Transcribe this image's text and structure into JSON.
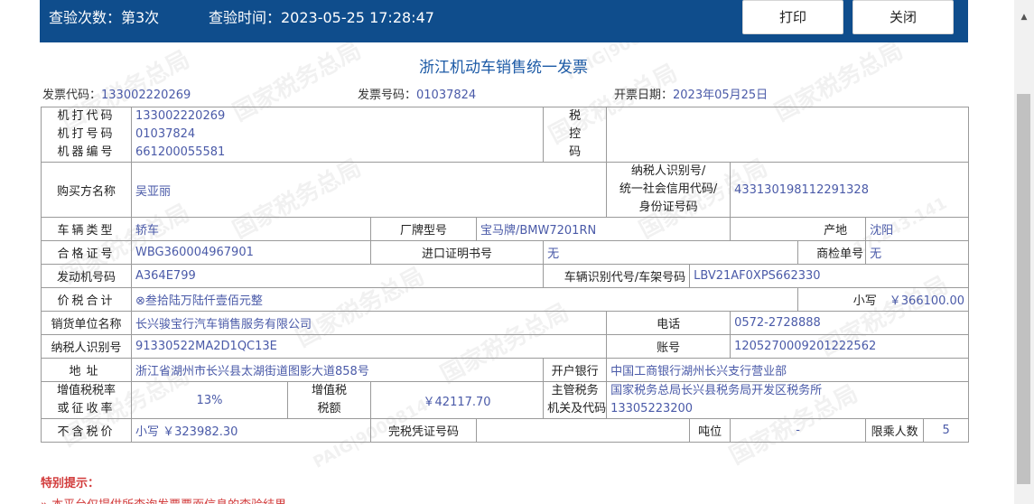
{
  "header": {
    "check_count": "查验次数：第3次",
    "check_time": "查验时间：2023-05-25 17:28:47",
    "print_label": "打印",
    "close_label": "关闭"
  },
  "invoice": {
    "title": "浙江机动车销售统一发票",
    "code_label": "发票代码：",
    "code": "133002220269",
    "number_label": "发票号码：",
    "number": "01037824",
    "date_label": "开票日期：",
    "date": "2023年05月25日",
    "machine_code_label": "机打代码",
    "machine_code": "133002220269",
    "machine_no_label": "机打号码",
    "machine_no": "01037824",
    "device_no_label": "机器编号",
    "device_no": "661200055581",
    "tax_control_label": "税控码",
    "tax_control": "",
    "buyer_label": "购买方名称",
    "buyer": "吴亚丽",
    "taxpayer_id_label": "纳税人识别号/统一社会信用代码/身份证号码",
    "taxpayer_id_line1": "纳税人识别号/",
    "taxpayer_id_line2": "统一社会信用代码/",
    "taxpayer_id_line3": "身份证号码",
    "taxpayer_id": "433130198112291328",
    "vehicle_type_label": "车辆类型",
    "vehicle_type": "轿车",
    "brand_label": "厂牌型号",
    "brand": "宝马牌/BMW7201RN",
    "origin_label": "产地",
    "origin": "沈阳",
    "cert_label": "合格证号",
    "cert": "WBG360004967901",
    "import_label": "进口证明书号",
    "import": "无",
    "inspect_label": "商检单号",
    "inspect": "无",
    "engine_label": "发动机号码",
    "engine": "A364E799",
    "vin_label": "车辆识别代号/车架号码",
    "vin": "LBV21AF0XPS662330",
    "total_label": "价税合计",
    "total_upper": "⊗叁拾陆万陆仟壹佰元整",
    "small_label": "小写",
    "total_small": "￥366100.00",
    "seller_label": "销货单位名称",
    "seller": "长兴骏宝行汽车销售服务有限公司",
    "phone_label": "电话",
    "phone": "0572-2728888",
    "seller_tax_label": "纳税人识别号",
    "seller_tax": "91330522MA2D1QC13E",
    "account_label": "账号",
    "account": "1205270009201222562",
    "address_label": "地址",
    "address": "浙江省湖州市长兴县太湖街道图影大道858号",
    "bank_label": "开户银行",
    "bank": "中国工商银行湖州长兴支行营业部",
    "vat_rate_label_1": "增值税税率",
    "vat_rate_label_2": "或征收率",
    "vat_rate": "13%",
    "vat_amount_label_1": "增值税",
    "vat_amount_label_2": "税额",
    "vat_amount": "￥42117.70",
    "tax_office_label_1": "主管税务",
    "tax_office_label_2": "机关及代码",
    "tax_office_name": "国家税务总局长兴县税务局开发区税务所",
    "tax_office_code": "13305223200",
    "pretax_label": "不含税价",
    "pretax": "小写 ￥323982.30",
    "duty_label": "完税凭证号码",
    "duty": "",
    "tonnage_label": "吨位",
    "tonnage": "-",
    "seats_label": "限乘人数",
    "seats": "5"
  },
  "notice": {
    "title": "特别提示：",
    "line1": "» 本平台仅提供所查询发票票面信息的查验结果"
  },
  "watermark": {
    "text": "国家税务总局",
    "text2": "PAIG|9009814",
    "text3": "17.243.141"
  },
  "colors": {
    "topbar": "#0f4d8c",
    "title": "#1c5aa6",
    "value": "#4a5aa8",
    "notice": "#d23c3c"
  }
}
